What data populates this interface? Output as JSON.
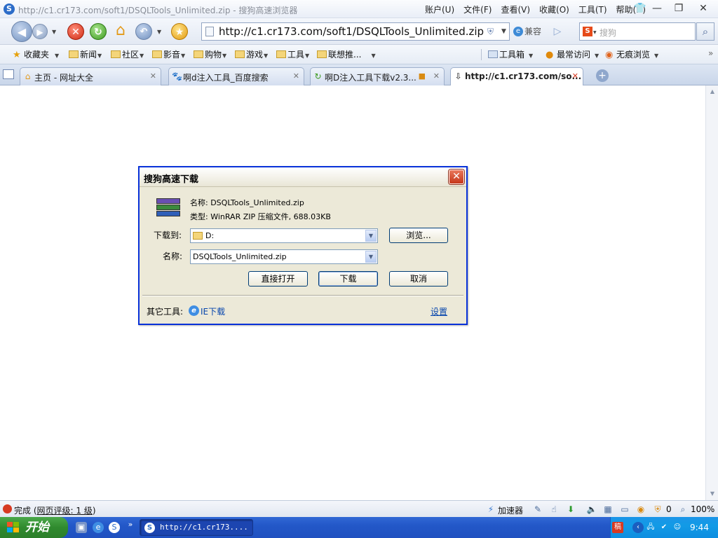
{
  "window": {
    "title": "http://c1.cr173.com/soft1/DSQLTools_Unlimited.zip - 搜狗高速浏览器",
    "menus": [
      "账户(U)",
      "文件(F)",
      "查看(V)",
      "收藏(O)",
      "工具(T)",
      "帮助(H)"
    ],
    "minimize": "—",
    "restore": "❐",
    "close": "✕"
  },
  "nav": {
    "url": "http://c1.cr173.com/soft1/DSQLTools_Unlimited.zip",
    "compat_label": "兼容",
    "search_placeholder": "搜狗"
  },
  "bookmarks": {
    "favorites": "收藏夹",
    "folders": [
      "新闻",
      "社区",
      "影音",
      "购物",
      "游戏",
      "工具",
      "联想推..."
    ],
    "toolbox": "工具箱",
    "most_visited": "最常访问",
    "private_browse": "无痕浏览"
  },
  "tabs": [
    {
      "label": "主页 - 网址大全",
      "active": false
    },
    {
      "label": "啊d注入工具_百度搜索",
      "active": false
    },
    {
      "label": "啊D注入工具下载v2.3...",
      "active": false
    },
    {
      "label": "http://c1.cr173.com/so...",
      "active": true
    }
  ],
  "dialog": {
    "title": "搜狗高速下载",
    "file_name_line": "名称: DSQLTools_Unlimited.zip",
    "file_type_line": "类型: WinRAR ZIP 压缩文件, 688.03KB",
    "save_to_label": "下载到:",
    "save_to_value": "D:",
    "browse_button": "浏览...",
    "name_label": "名称:",
    "name_value": "DSQLTools_Unlimited.zip",
    "open_direct_button": "直接打开",
    "download_button": "下载",
    "cancel_button": "取消",
    "other_tools_label": "其它工具:",
    "ie_download_link": "IE下载",
    "settings_link": "设置"
  },
  "status": {
    "done": "完成",
    "rating": "网页评级: 1 级",
    "accelerator": "加速器",
    "count": "0",
    "zoom": "100%"
  },
  "taskbar": {
    "start": "开始",
    "window_label": "http://c1.cr173....",
    "clock": "9:44"
  }
}
